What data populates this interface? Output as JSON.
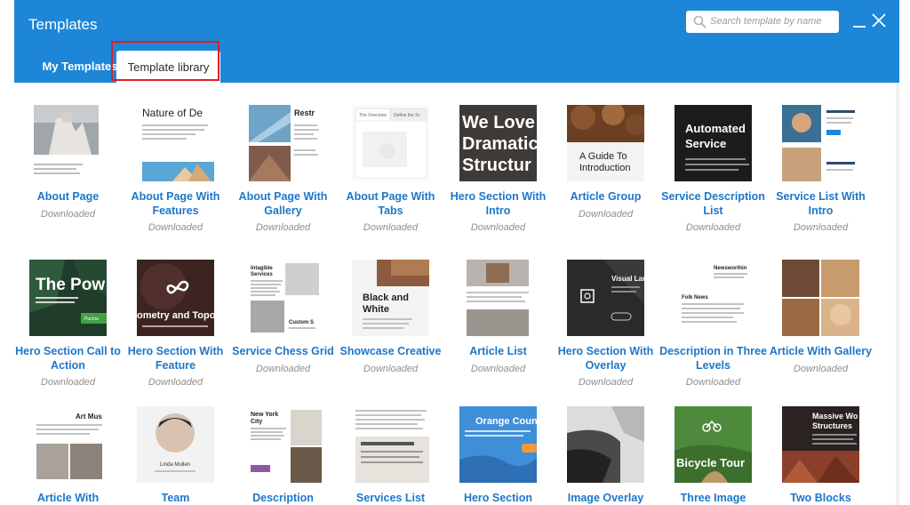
{
  "header": {
    "title": "Templates",
    "search_placeholder": "Search template by name",
    "tabs": [
      {
        "label": "My Templates"
      },
      {
        "label": "Template library"
      }
    ]
  },
  "thumb_text": {
    "t1": "Nature of De",
    "t2": "Restr",
    "t3": "The Overview",
    "t4": "Define the Sc",
    "t5": "We Love Dramatic Structur",
    "t6": "A Guide To Introduction",
    "t7": "Automated Service",
    "t8": "Customer service is the customers before, du",
    "t9": "Service Spec",
    "t10": "Economic Sr",
    "t11": "The Pow",
    "t12": "Purcha",
    "t13": "ometry and Topol",
    "t14": "Intagible Services",
    "t15": "Custom S",
    "t16": "Black and White",
    "t17": "Visual Lan",
    "t18": "Newsworthin",
    "t19": "Folk News",
    "t20": "Art Mus",
    "t21": "Linda Mullen",
    "t22": "New York City",
    "t23": "Orange Count",
    "t24": "Bicycle Tour",
    "t25": "Massive Wo Structures"
  },
  "templates": [
    {
      "name": "About Page",
      "status": "Downloaded"
    },
    {
      "name": "About Page With Features",
      "status": "Downloaded"
    },
    {
      "name": "About Page With Gallery",
      "status": "Downloaded"
    },
    {
      "name": "About Page With Tabs",
      "status": "Downloaded"
    },
    {
      "name": "Hero Section With Intro",
      "status": "Downloaded"
    },
    {
      "name": "Article Group",
      "status": "Downloaded"
    },
    {
      "name": "Service Description List",
      "status": "Downloaded"
    },
    {
      "name": "Service List With Intro",
      "status": "Downloaded"
    },
    {
      "name": "Hero Section Call to Action",
      "status": "Downloaded"
    },
    {
      "name": "Hero Section With Feature",
      "status": "Downloaded"
    },
    {
      "name": "Service Chess Grid",
      "status": "Downloaded"
    },
    {
      "name": "Showcase Creative",
      "status": "Downloaded"
    },
    {
      "name": "Article List",
      "status": "Downloaded"
    },
    {
      "name": "Hero Section With Overlay",
      "status": "Downloaded"
    },
    {
      "name": "Description in Three Levels",
      "status": "Downloaded"
    },
    {
      "name": "Article With Gallery",
      "status": "Downloaded"
    },
    {
      "name": "Article With",
      "status": ""
    },
    {
      "name": "Team",
      "status": ""
    },
    {
      "name": "Description",
      "status": ""
    },
    {
      "name": "Services List",
      "status": ""
    },
    {
      "name": "Hero Section",
      "status": ""
    },
    {
      "name": "Image Overlay",
      "status": ""
    },
    {
      "name": "Three Image",
      "status": ""
    },
    {
      "name": "Two Blocks",
      "status": ""
    }
  ],
  "colors": {
    "header": "#1e86d6",
    "link": "#1d77c9",
    "status": "#8f8f8f",
    "highlight": "#e31b23"
  }
}
